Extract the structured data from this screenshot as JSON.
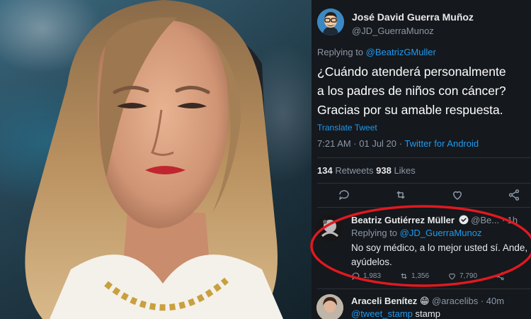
{
  "tweet": {
    "author_name": "José David Guerra Muñoz",
    "author_handle": "@JD_GuerraMunoz",
    "replying_prefix": "Replying to ",
    "replying_handle": "@BeatrizGMuller",
    "text_line1": "¿Cuándo atenderá personalmente",
    "text_line2": "a los padres de niños con cáncer?",
    "text_line3": "Gracias por su amable respuesta.",
    "translate": "Translate Tweet",
    "timestamp": "7:21 AM · 01 Jul 20 · ",
    "client": "Twitter for Android",
    "retweets_count": "134",
    "retweets_label": " Retweets ",
    "likes_count": "938",
    "likes_label": " Likes"
  },
  "reply": {
    "author_name": "Beatriz Gutiérrez Müller",
    "author_handle": " @Be...",
    "time": " · 1h",
    "replying_prefix": "Replying to ",
    "replying_handle": "@JD_GuerraMunoz",
    "text_line1": "No soy médico, a lo mejor usted sí. Ande,",
    "text_line2": "ayúdelos.",
    "reply_count": "1,983",
    "retweet_count": "1,356",
    "like_count": "7,790"
  },
  "third": {
    "author_name": "Araceli Benítez",
    "emoji": "😁",
    "author_handle": " @aracelibs",
    "time": " · 40m",
    "mention": "@tweet_stamp",
    "text": " stamp"
  },
  "colors": {
    "background": "#15181d",
    "link": "#1d9bf0",
    "muted": "#8b98a5",
    "highlight_ellipse": "#e0191f"
  },
  "icons": [
    "reply-icon",
    "retweet-icon",
    "like-icon",
    "share-icon",
    "verified-icon"
  ]
}
